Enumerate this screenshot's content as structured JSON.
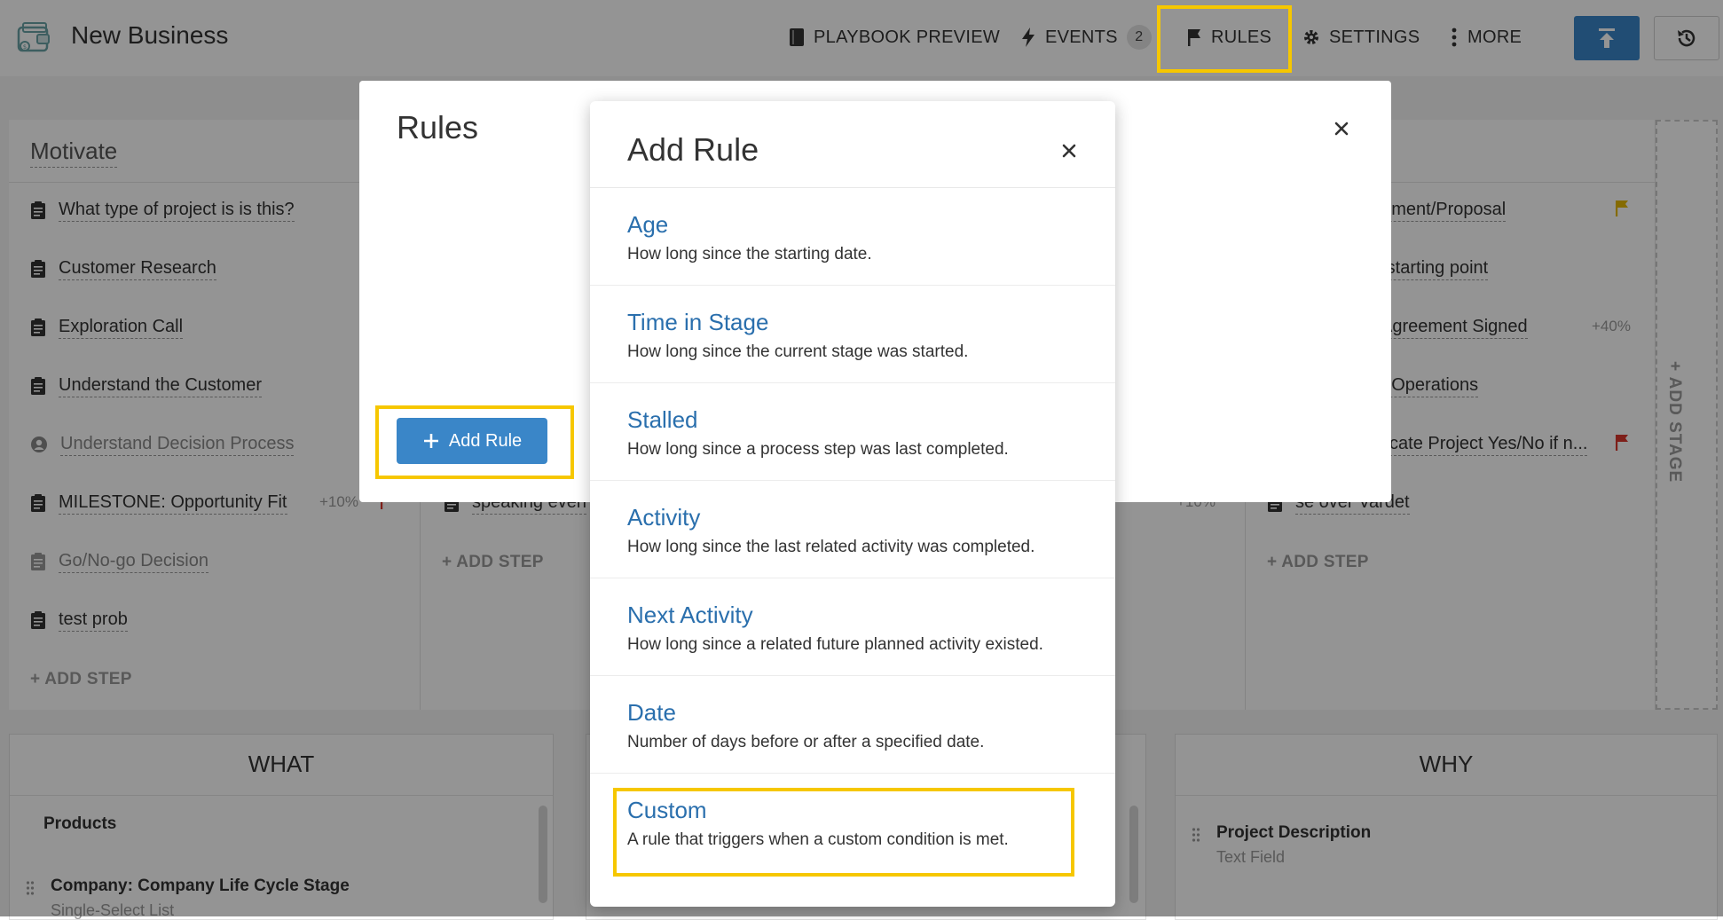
{
  "header": {
    "title": "New Business",
    "nav": {
      "playbook_preview": "PLAYBOOK PREVIEW",
      "events": "EVENTS",
      "events_count": "2",
      "rules": "RULES",
      "settings": "SETTINGS",
      "more": "MORE"
    }
  },
  "stages": [
    {
      "title": "Motivate",
      "steps": [
        {
          "label": "What type of project is is this?"
        },
        {
          "label": "Customer Research"
        },
        {
          "label": "Exploration Call"
        },
        {
          "label": "Understand the Customer"
        },
        {
          "label": "Understand Decision Process"
        },
        {
          "label": "MILESTONE: Opportunity Fit",
          "pct": "+10%"
        },
        {
          "label": "Go/No-go Decision"
        },
        {
          "label": "test prob"
        }
      ],
      "add_step": "+ ADD STEP"
    },
    {
      "steps": [
        {
          "label": "speaking even"
        }
      ],
      "add_step": "+ ADD STEP",
      "pct": "+10%"
    },
    {
      "steps": [
        {
          "label": "eement/Proposal"
        },
        {
          "label": "e starting point"
        },
        {
          "label": ": Agreement Signed",
          "pct": "+40%"
        },
        {
          "label": "to Operations"
        },
        {
          "label": "plicate Project Yes/No if n..."
        },
        {
          "label": "se over Vardet"
        }
      ],
      "add_step": "+ ADD STEP"
    }
  ],
  "add_stage": "+ ADD STAGE",
  "panels": {
    "what": {
      "title": "WHAT",
      "section": "Products",
      "field_name": "Company: Company Life Cycle Stage",
      "field_type": "Single-Select List"
    },
    "why": {
      "title": "WHY",
      "field_name": "Project Description",
      "field_type": "Text Field"
    }
  },
  "rules_dialog": {
    "title": "Rules",
    "add_rule_label": "Add Rule"
  },
  "add_rule_modal": {
    "title": "Add Rule",
    "options": [
      {
        "name": "Age",
        "desc": "How long since the starting date."
      },
      {
        "name": "Time in Stage",
        "desc": "How long since the current stage was started."
      },
      {
        "name": "Stalled",
        "desc": "How long since a process step was last completed."
      },
      {
        "name": "Activity",
        "desc": "How long since the last related activity was completed."
      },
      {
        "name": "Next Activity",
        "desc": "How long since a related future planned activity existed."
      },
      {
        "name": "Date",
        "desc": "Number of days before or after a specified date."
      },
      {
        "name": "Custom",
        "desc": "A rule that triggers when a custom condition is met."
      }
    ]
  },
  "colors": {
    "accent": "#3a86c8",
    "highlight": "#f6c700",
    "link": "#2a6fad",
    "flag_yellow": "#e6b800",
    "flag_red": "#d9362b"
  }
}
